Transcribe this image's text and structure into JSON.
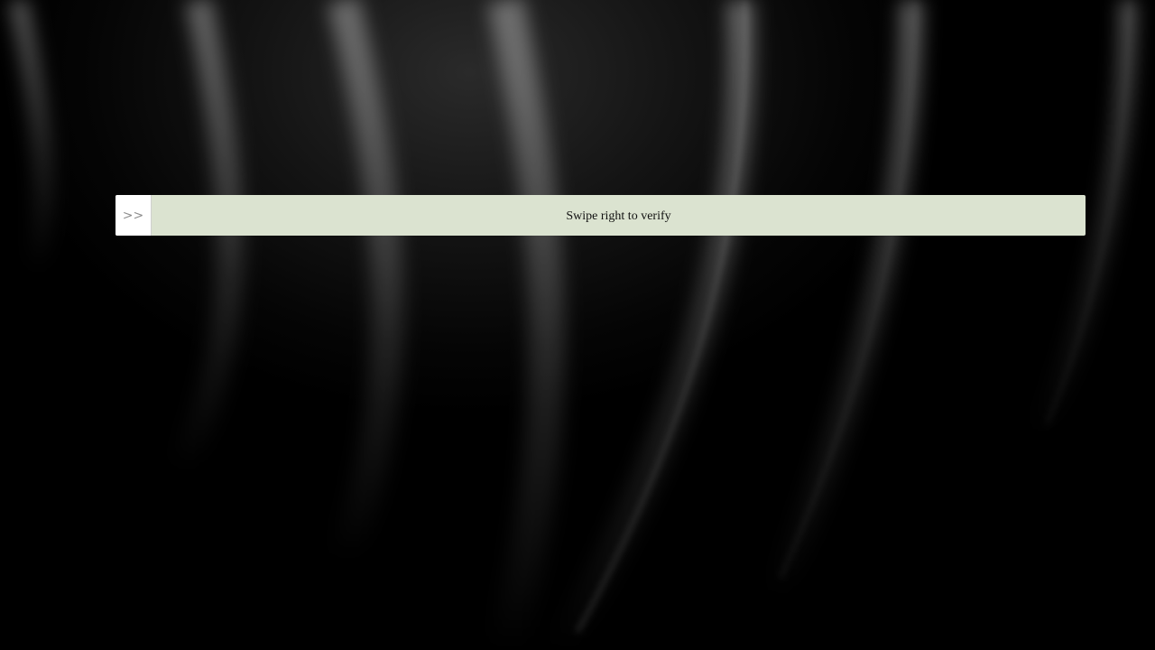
{
  "verify_slider": {
    "handle_glyph": ">>",
    "label": "Swipe right to verify",
    "progress": 0
  },
  "colors": {
    "background": "#000000",
    "track": "#dbe3d0",
    "handle": "#ffffff",
    "handle_glyph": "#8a8a8a",
    "label_text": "#111111"
  }
}
